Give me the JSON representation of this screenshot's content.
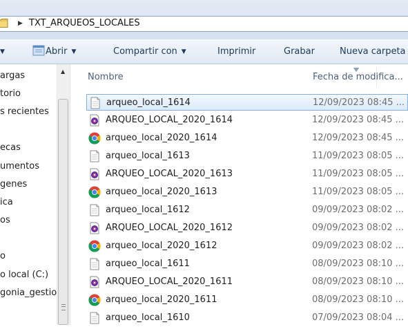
{
  "address_bar": {
    "path_folder": "TXT_ARQUEOS_LOCALES"
  },
  "toolbar": {
    "open_label": "Abrir",
    "share_label": "Compartir con",
    "print_label": "Imprimir",
    "burn_label": "Grabar",
    "new_folder_label": "Nueva carpeta"
  },
  "nav": {
    "items": [
      "argas",
      "torio",
      "s recientes",
      "ecas",
      "umentos",
      "genes",
      "ica",
      "os",
      "o",
      "o local (C:)",
      "gonia_gestio"
    ]
  },
  "columns": {
    "name": "Nombre",
    "date": "Fecha de modifica..."
  },
  "files": [
    {
      "name": "arqueo_local_1614",
      "date": "12/09/2023 08:45 ...",
      "icon": "text-file-icon",
      "selected": true
    },
    {
      "name": "ARQUEO_LOCAL_2020_1614",
      "date": "12/09/2023 08:45 ...",
      "icon": "app-file-icon"
    },
    {
      "name": "arqueo_local_2020_1614",
      "date": "12/09/2023 08:45 ...",
      "icon": "chrome-icon"
    },
    {
      "name": "arqueo_local_1613",
      "date": "11/09/2023 08:05 ...",
      "icon": "text-file-icon"
    },
    {
      "name": "ARQUEO_LOCAL_2020_1613",
      "date": "11/09/2023 08:05 ...",
      "icon": "app-file-icon"
    },
    {
      "name": "arqueo_local_2020_1613",
      "date": "11/09/2023 08:05 ...",
      "icon": "chrome-icon"
    },
    {
      "name": "arqueo_local_1612",
      "date": "09/09/2023 08:02 ...",
      "icon": "text-file-icon"
    },
    {
      "name": "ARQUEO_LOCAL_2020_1612",
      "date": "09/09/2023 08:02 ...",
      "icon": "app-file-icon"
    },
    {
      "name": "arqueo_local_2020_1612",
      "date": "09/09/2023 08:02 ...",
      "icon": "chrome-icon"
    },
    {
      "name": "arqueo_local_1611",
      "date": "08/09/2023 08:10 ...",
      "icon": "text-file-icon"
    },
    {
      "name": "ARQUEO_LOCAL_2020_1611",
      "date": "08/09/2023 08:10 ...",
      "icon": "app-file-icon"
    },
    {
      "name": "arqueo_local_2020_1611",
      "date": "08/09/2023 08:10 ...",
      "icon": "chrome-icon"
    },
    {
      "name": "arqueo_local_1610",
      "date": "07/09/2023 08:04 ...",
      "icon": "text-file-icon"
    }
  ]
}
